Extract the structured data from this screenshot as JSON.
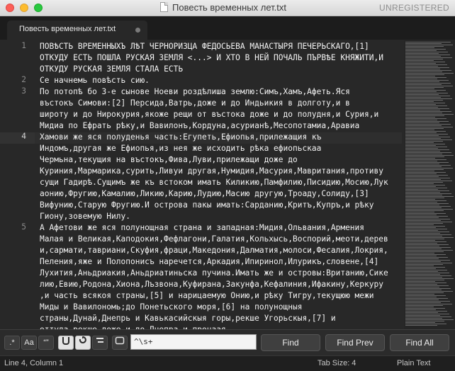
{
  "window": {
    "title": "Повесть временных лет.txt",
    "unregistered": "UNREGISTERED"
  },
  "tab": {
    "label": "Повесть временных лет.txt"
  },
  "editor": {
    "gutter": [
      {
        "num": "1",
        "row": 0,
        "active": false
      },
      {
        "num": "2",
        "row": 3,
        "active": false
      },
      {
        "num": "3",
        "row": 4,
        "active": false
      },
      {
        "num": "4",
        "row": 8,
        "active": true
      },
      {
        "num": "5",
        "row": 16,
        "active": false
      }
    ],
    "lines": [
      "ПОВѢСТЬ ВРЕМЕННЫХЪ ЛѢТ ЧЕРНОРИЗЦА ФЕДОСЬЕВА МАНАСТЫРЯ ПЕЧЕРЬСКАГО,[1]",
      "ОТКУДУ ЕСТЬ ПОШЛА РУСКАЯ ЗЕМЛЯ <...> И ХТО В НЕЙ ПОЧАЛЬ ПЪРВѢЕ КНЯЖИТИ,И",
      "ОТКУДУ РУСКАЯ ЗЕМЛЯ СТАЛА ЕСТЬ",
      "Се начнемь повѣсть сию.",
      "По потопѣ бо 3-е сынове Ноеви роздѣлиша землю:Симъ,Хамъ,Афеть.Яся",
      "въстокъ Симови:[2] Персида,Ватрь,доже и до Индьикия в долготу,и в",
      "широту и до Нирокурия,якоже рещи от въстока доже и до полудня,и Сурия,и",
      "Мидиа по Ефрать рѣку,и Вавилонъ,Кордуна,асурианѣ,Месопотамиа,Аравиа",
      "Хамови же яся полуденья часть:Егупеть,Ефиопья,прилежащия къ",
      "Индомъ,другая же Ефиопья,из нея же исходить рѣка ефиопьскаа",
      "Чермьна,текущия на въстокъ,Фива,Луви,прилежащи доже до",
      "Куриния,Мармарика,сурить,Ливуи другая,Нумидия,Масурия,Мавритания,противу",
      "сущи Гадирѣ.Сущимъ же къ встоком имать Киликию,Памфилию,Писидию,Мосию,Лук",
      "аонию,Фругию,Камалию,Ликию,Карию,Лудию,Масию другую,Троаду,Солиду,[3]",
      "Вифунию,Старую Фругию.И острова пакы имать:Сарданию,Критъ,Купръ,и рѣку",
      "Гиону,зовемую Нилу.",
      "А Афетови же яся полунощная страна и западная:Мидия,Ольвания,Армения",
      "Малая и Великая,Каподокия,Фефлагони,Галатия,Кольхысь,Воспорий,меоти,дерев",
      "и,сармати,тавриани,Скуфия,фраци,Македония,Далматия,молоси,Фесалия,Локрия,",
      "Пеления,яже и Полопонисъ наречется,Аркадия,Ипиринол,Илурикъ,словене,[4]",
      "Лухития,Аньдриакия,Аньдриатиньска пучина.Имать же и островы:Вританию,Сике",
      "лию,Евию,Родона,Хиона,Лъзвона,Куфирана,Закунфа,Кефалиния,Ифакину,Керкуру",
      ",и часть всякоя страны,[5] и нарицаемую Онию,и рѣку Тигру,текущюю межи",
      "Миды и Вавилономь;до Понетьского моря,[6] на полунощныя",
      "страны,Дунай,Днепрь и Кавькасийскыя горы,рекше Угорьскыя,[7] и",
      "оттуда,рекше,доже и до Днепра,и прочаая"
    ]
  },
  "findbar": {
    "regex_label": ".*",
    "case_label": "Aa",
    "word_label": "“”",
    "query": "^\\s+",
    "find_label": "Find",
    "find_prev_label": "Find Prev",
    "find_all_label": "Find All"
  },
  "status": {
    "position": "Line 4, Column 1",
    "tab_size": "Tab Size: 4",
    "syntax": "Plain Text"
  }
}
